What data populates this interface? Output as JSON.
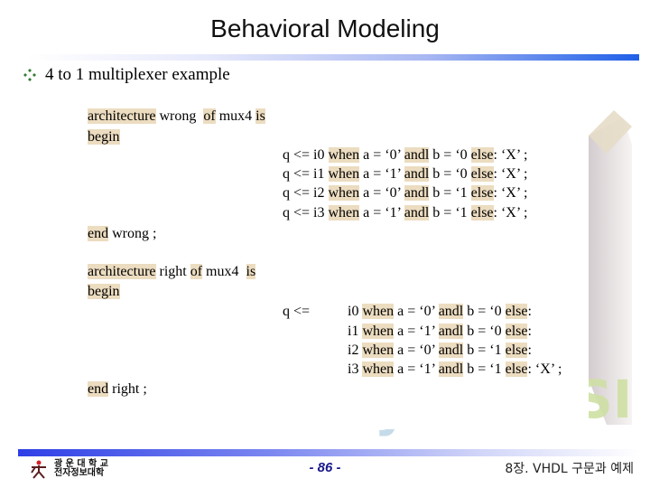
{
  "slide": {
    "title": "Behavioral Modeling",
    "bullet": "4 to 1 multiplexer example",
    "colors": {
      "keyword_highlight": "#ecdcc0",
      "bullet": "#2e7d32",
      "accent": "#1f5fe8"
    }
  },
  "wrong_arch": {
    "header": [
      "architecture",
      "wrong",
      "of",
      "mux4",
      "is"
    ],
    "begin": "begin",
    "lines": [
      {
        "lhs": "q <= i0",
        "when": "when",
        "cond_a": "a = ‘0’",
        "and": "andl",
        "cond_b": "b = ‘0",
        "else": "else",
        "tail": ": ‘X’ ;"
      },
      {
        "lhs": "q <= i1",
        "when": "when",
        "cond_a": "a = ‘1’",
        "and": "andl",
        "cond_b": "b = ‘0",
        "else": "else",
        "tail": ": ‘X’ ;"
      },
      {
        "lhs": "q <= i2",
        "when": "when",
        "cond_a": "a = ‘0’",
        "and": "andl",
        "cond_b": "b = ‘1",
        "else": "else",
        "tail": ": ‘X’ ;"
      },
      {
        "lhs": "q <= i3",
        "when": "when",
        "cond_a": "a = ‘1’",
        "and": "andl",
        "cond_b": "b = ‘1",
        "else": "else",
        "tail": ": ‘X’ ;"
      }
    ],
    "end": "end",
    "end_tail": "wrong ;"
  },
  "right_arch": {
    "header": [
      "architecture",
      "right",
      "of",
      "mux4",
      "is"
    ],
    "begin": "begin",
    "assign": "q <=",
    "lines": [
      {
        "sig": "i0",
        "when": "when",
        "cond_a": "a = ‘0’",
        "and": "andl",
        "cond_b": "b = ‘0",
        "else": "else",
        "tail": ":"
      },
      {
        "sig": "i1",
        "when": "when",
        "cond_a": "a = ‘1’",
        "and": "andl",
        "cond_b": "b = ‘0",
        "else": "else",
        "tail": ":"
      },
      {
        "sig": "i2",
        "when": "when",
        "cond_a": "a = ‘0’",
        "and": "andl",
        "cond_b": "b = ‘1",
        "else": "else",
        "tail": ":"
      },
      {
        "sig": "i3",
        "when": "when",
        "cond_a": "a = ‘1’",
        "and": "andl",
        "cond_b": "b = ‘1",
        "else": "else",
        "tail": ": ‘X’ ;"
      }
    ],
    "end": "end",
    "end_tail": "right ;"
  },
  "footer": {
    "page_number": "- 86 -",
    "chapter": "8장. VHDL 구문과 예제",
    "logo_line1": "광 운 대 학 교",
    "logo_line2": "전자정보대학"
  }
}
